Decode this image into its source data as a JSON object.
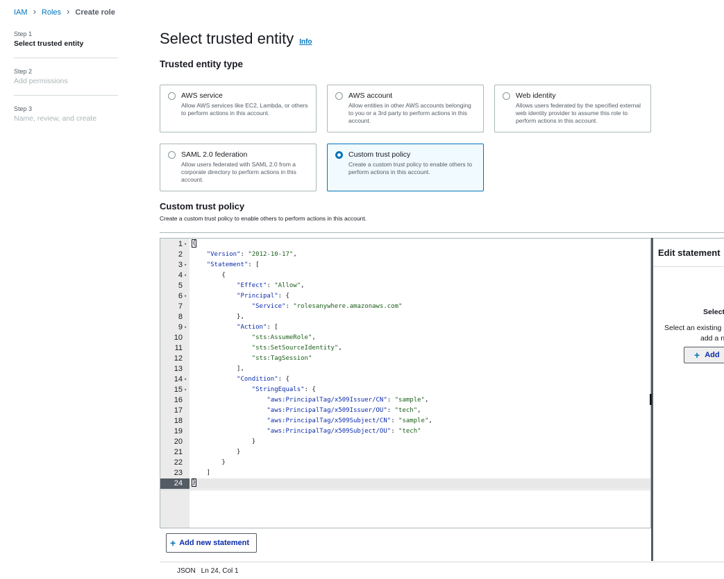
{
  "breadcrumb": {
    "iam": "IAM",
    "roles": "Roles",
    "current": "Create role"
  },
  "steps": [
    {
      "num": "Step 1",
      "title": "Select trusted entity",
      "state": "active"
    },
    {
      "num": "Step 2",
      "title": "Add permissions",
      "state": "inactive"
    },
    {
      "num": "Step 3",
      "title": "Name, review, and create",
      "state": "inactive"
    }
  ],
  "page": {
    "title": "Select trusted entity",
    "info": "Info"
  },
  "trusted_entity": {
    "section_title": "Trusted entity type",
    "options": [
      {
        "title": "AWS service",
        "desc": "Allow AWS services like EC2, Lambda, or others to perform actions in this account.",
        "selected": false
      },
      {
        "title": "AWS account",
        "desc": "Allow entities in other AWS accounts belonging to you or a 3rd party to perform actions in this account.",
        "selected": false
      },
      {
        "title": "Web identity",
        "desc": "Allows users federated by the specified external web identity provider to assume this role to perform actions in this account.",
        "selected": false
      },
      {
        "title": "SAML 2.0 federation",
        "desc": "Allow users federated with SAML 2.0 from a corporate directory to perform actions in this account.",
        "selected": false
      },
      {
        "title": "Custom trust policy",
        "desc": "Create a custom trust policy to enable others to perform actions in this account.",
        "selected": true
      }
    ]
  },
  "custom_policy": {
    "title": "Custom trust policy",
    "desc": "Create a custom trust policy to enable others to perform actions in this account."
  },
  "editor": {
    "active_line": 24,
    "lines": [
      {
        "n": "1",
        "fold": true,
        "text": "{"
      },
      {
        "n": "2",
        "fold": false,
        "text": "    \"Version\": \"2012-10-17\","
      },
      {
        "n": "3",
        "fold": true,
        "text": "    \"Statement\": ["
      },
      {
        "n": "4",
        "fold": true,
        "text": "        {"
      },
      {
        "n": "5",
        "fold": false,
        "text": "            \"Effect\": \"Allow\","
      },
      {
        "n": "6",
        "fold": true,
        "text": "            \"Principal\": {"
      },
      {
        "n": "7",
        "fold": false,
        "text": "                \"Service\": \"rolesanywhere.amazonaws.com\""
      },
      {
        "n": "8",
        "fold": false,
        "text": "            },"
      },
      {
        "n": "9",
        "fold": true,
        "text": "            \"Action\": ["
      },
      {
        "n": "10",
        "fold": false,
        "text": "                \"sts:AssumeRole\","
      },
      {
        "n": "11",
        "fold": false,
        "text": "                \"sts:SetSourceIdentity\","
      },
      {
        "n": "12",
        "fold": false,
        "text": "                \"sts:TagSession\""
      },
      {
        "n": "13",
        "fold": false,
        "text": "            ],"
      },
      {
        "n": "14",
        "fold": true,
        "text": "            \"Condition\": {"
      },
      {
        "n": "15",
        "fold": true,
        "text": "                \"StringEquals\": {"
      },
      {
        "n": "16",
        "fold": false,
        "text": "                    \"aws:PrincipalTag/x509Issuer/CN\": \"sample\","
      },
      {
        "n": "17",
        "fold": false,
        "text": "                    \"aws:PrincipalTag/x509Issuer/OU\": \"tech\","
      },
      {
        "n": "18",
        "fold": false,
        "text": "                    \"aws:PrincipalTag/x509Subject/CN\": \"sample\","
      },
      {
        "n": "19",
        "fold": false,
        "text": "                    \"aws:PrincipalTag/x509Subject/OU\": \"tech\""
      },
      {
        "n": "20",
        "fold": false,
        "text": "                }"
      },
      {
        "n": "21",
        "fold": false,
        "text": "            }"
      },
      {
        "n": "22",
        "fold": false,
        "text": "        }"
      },
      {
        "n": "23",
        "fold": false,
        "text": "    ]"
      },
      {
        "n": "24",
        "fold": false,
        "text": "}"
      }
    ],
    "add_statement": "Add new statement",
    "status_mode": "JSON",
    "status_position": "Ln 24, Col 1"
  },
  "side_panel": {
    "header": "Edit statement",
    "select_title": "Select",
    "desc_line1": "Select an existing",
    "desc_line2": "add a n",
    "add_label": "Add"
  },
  "colors": {
    "accent": "#0073bb",
    "selected_bg": "#f1faff",
    "code_key": "#0b2bab",
    "code_string": "#1a5d1a"
  }
}
